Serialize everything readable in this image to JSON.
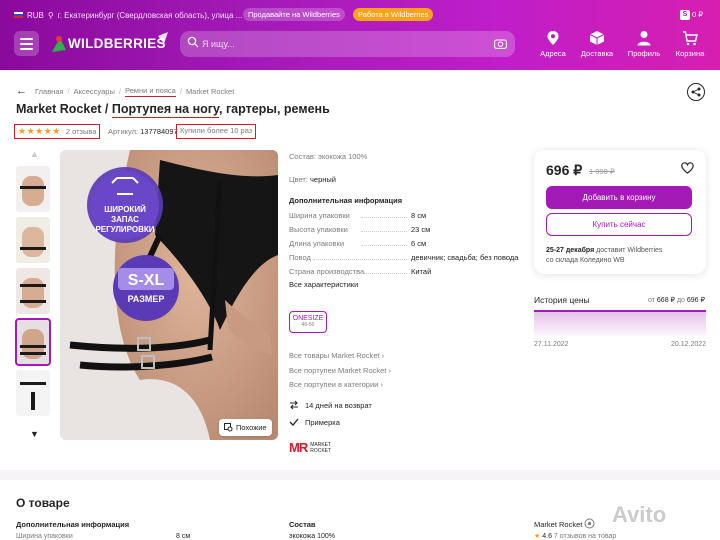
{
  "header": {
    "currency": "RUB",
    "location": "г. Екатеринбург (Свердловская область), улица ...",
    "sell_pill": "Продавайте на Wildberries",
    "work_pill": "Работа в Wildberries",
    "balance": "0 ₽",
    "logo": "WILDBERRIES",
    "search_placeholder": "Я ищу...",
    "nav": {
      "addresses": "Адреса",
      "delivery": "Доставка",
      "profile": "Профиль",
      "cart": "Корзина"
    }
  },
  "breadcrumb": {
    "home": "Главная",
    "accessories": "Аксессуары",
    "belts": "Ремни и пояса",
    "brand": "Market Rocket"
  },
  "product": {
    "title_brand": "Market Rocket / ",
    "title_name": "Портупея на ногу",
    "title_rest": ", гартеры, ремень",
    "stars": "★★★★★",
    "reviews": "2 отзыва",
    "article_label": "Артикул:",
    "article_value": "137784097",
    "bought": "Купили более 10 раз"
  },
  "gallery": {
    "similar": "Похожие"
  },
  "details": {
    "composition_label": "Состав:",
    "composition_value": "экокожа 100%",
    "color_label": "Цвет:",
    "color_value": "черный",
    "extra_head": "Дополнительная информация",
    "specs": [
      {
        "label": "Ширина упаковки",
        "value": "8 см"
      },
      {
        "label": "Высота упаковки",
        "value": "23 см"
      },
      {
        "label": "Длина упаковки",
        "value": "6 см"
      },
      {
        "label": "Повод",
        "value": "девичник; свадьба; без повода"
      },
      {
        "label": "Страна производства",
        "value": "Китай"
      }
    ],
    "all_chars": "Все характеристики",
    "size": "ONESIZE",
    "size_sub": "46-50",
    "links": [
      "Все товары Market Rocket ›",
      "Все портупеи Market Rocket ›",
      "Все портупеи в категории ›"
    ],
    "return": "14 дней на возврат",
    "fitting": "Примерка",
    "brand_logo_mark": "MR",
    "brand_logo_text1": "MARKET",
    "brand_logo_text2": "ROCKET"
  },
  "price_card": {
    "price": "696 ₽",
    "old_price": "1 990 ₽",
    "add_to_cart": "Добавить в корзину",
    "buy_now": "Купить сейчас",
    "delivery_date": "25-27 декабря",
    "delivery_by": "доставит Wildberries",
    "delivery_from": "со склада Коледино WB"
  },
  "price_history": {
    "title": "История цены",
    "range_prefix": "от",
    "range_from": "668 ₽",
    "range_mid": "до",
    "range_to": "696 ₽",
    "date_start": "27.11.2022",
    "date_end": "20.12.2022",
    "accent": "#a31ab7"
  },
  "about": {
    "title": "О товаре",
    "extra_head": "Дополнительная информация",
    "row1_label": "Ширина упаковки",
    "row1_value": "8 см",
    "composition_head": "Состав",
    "composition_value": "экокожа 100%",
    "brand": "Market Rocket",
    "rating": "4.6",
    "reviews": "7 отзывов на товар"
  },
  "watermark": "Avito",
  "colors": {
    "brand": "#a31ab7",
    "highlight": "#d11d2b",
    "star": "#ff9a1f"
  }
}
